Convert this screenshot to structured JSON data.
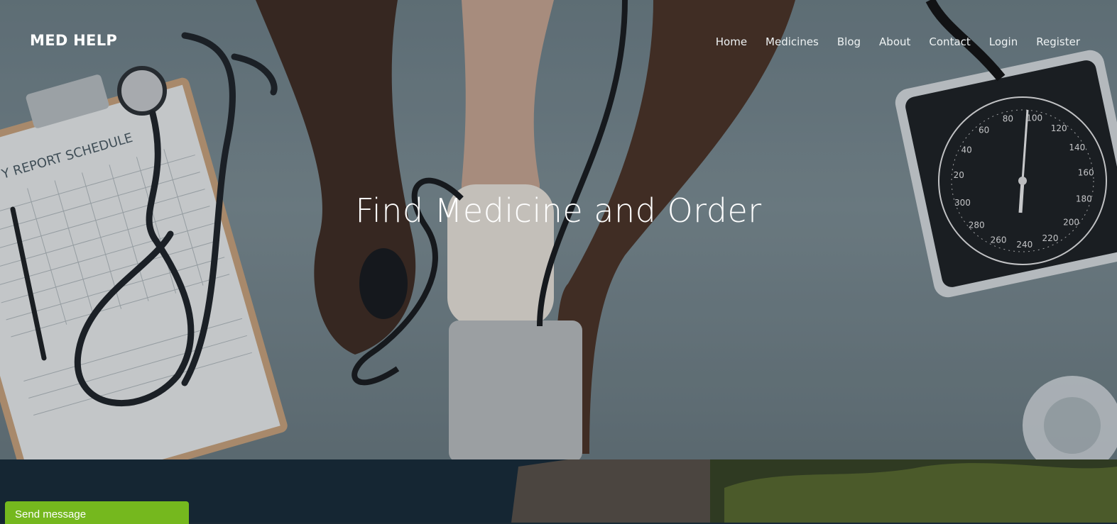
{
  "brand": {
    "name": "MED HELP"
  },
  "nav": {
    "items": [
      {
        "label": "Home"
      },
      {
        "label": "Medicines"
      },
      {
        "label": "Blog"
      },
      {
        "label": "About"
      },
      {
        "label": "Contact"
      },
      {
        "label": "Login"
      },
      {
        "label": "Register"
      }
    ]
  },
  "hero": {
    "title": "Find Medicine and Order",
    "clipboard_text": "Y REPORT SCHEDULE",
    "gauge_numbers": [
      "20",
      "40",
      "60",
      "80",
      "100",
      "120",
      "140",
      "160",
      "180",
      "200",
      "220",
      "240",
      "260",
      "280",
      "300"
    ]
  },
  "chat": {
    "label": "Send message"
  },
  "colors": {
    "chat_button": "#75b81e",
    "nav_text": "#eef2f3",
    "hero_bg": "#7c8d93",
    "section_dark": "#152633"
  }
}
